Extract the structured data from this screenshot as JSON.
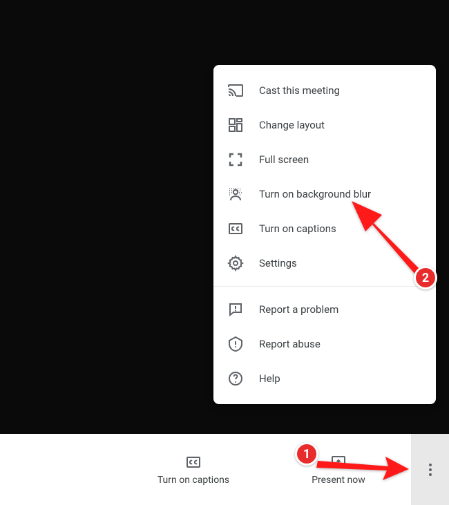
{
  "menu": {
    "section1": [
      {
        "id": "cast",
        "label": "Cast this meeting"
      },
      {
        "id": "layout",
        "label": "Change layout"
      },
      {
        "id": "fullscreen",
        "label": "Full screen"
      },
      {
        "id": "blur",
        "label": "Turn on background blur"
      },
      {
        "id": "captions",
        "label": "Turn on captions"
      },
      {
        "id": "settings",
        "label": "Settings"
      }
    ],
    "section2": [
      {
        "id": "report-problem",
        "label": "Report a problem"
      },
      {
        "id": "report-abuse",
        "label": "Report abuse"
      },
      {
        "id": "help",
        "label": "Help"
      }
    ]
  },
  "bottombar": {
    "captions_label": "Turn on captions",
    "present_label": "Present now"
  },
  "annotations": {
    "badge1": "1",
    "badge2": "2"
  }
}
